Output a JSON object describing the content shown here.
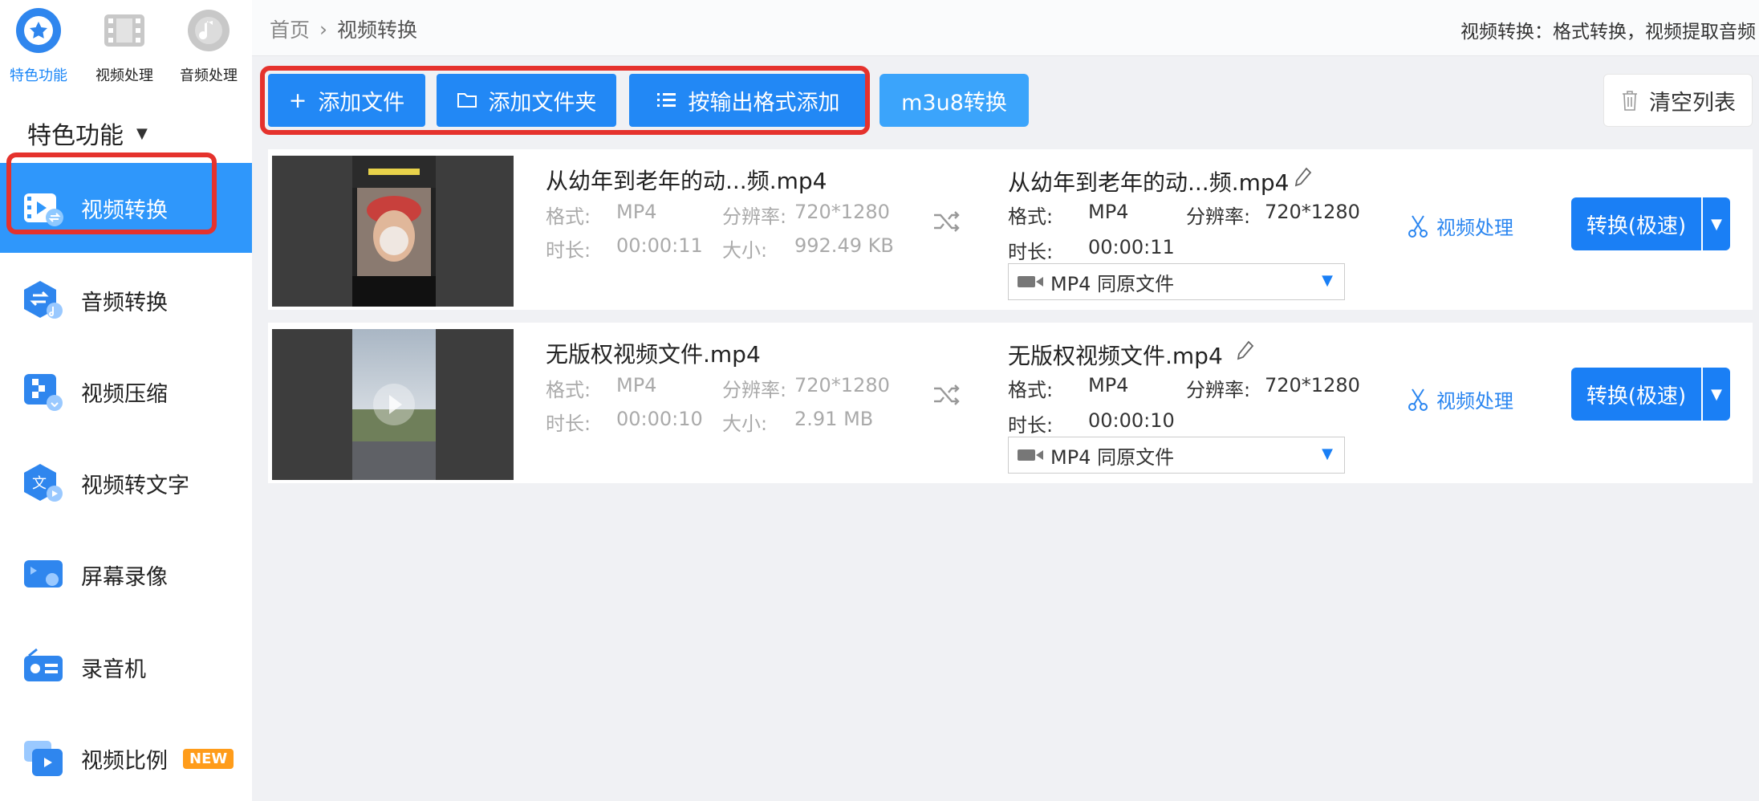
{
  "top_tabs": [
    {
      "label": "特色功能",
      "icon": "star-icon",
      "active": true
    },
    {
      "label": "视频处理",
      "icon": "film-icon",
      "active": false
    },
    {
      "label": "音频处理",
      "icon": "music-disc-icon",
      "active": false
    }
  ],
  "category": {
    "label": "特色功能"
  },
  "nav_items": [
    {
      "label": "视频转换",
      "icon": "video-convert-icon",
      "active": true
    },
    {
      "label": "音频转换",
      "icon": "audio-convert-icon"
    },
    {
      "label": "视频压缩",
      "icon": "video-compress-icon"
    },
    {
      "label": "视频转文字",
      "icon": "video-to-text-icon"
    },
    {
      "label": "屏幕录像",
      "icon": "screen-record-icon"
    },
    {
      "label": "录音机",
      "icon": "recorder-icon"
    },
    {
      "label": "视频比例",
      "icon": "video-ratio-icon",
      "badge": "NEW"
    }
  ],
  "header": {
    "breadcrumb_home": "首页",
    "breadcrumb_current": "视频转换",
    "description": "视频转换：格式转换，视频提取音频"
  },
  "toolbar": {
    "add_file": "添加文件",
    "add_folder": "添加文件夹",
    "add_by_format": "按输出格式添加",
    "m3u8": "m3u8转换",
    "clear_list": "清空列表"
  },
  "labels": {
    "format": "格式:",
    "resolution": "分辨率:",
    "duration": "时长:",
    "size": "大小:",
    "video_process": "视频处理",
    "convert": "转换(极速)"
  },
  "files": [
    {
      "name": "从幼年到老年的动...频.mp4",
      "format": "MP4",
      "resolution": "720*1280",
      "duration": "00:00:11",
      "size": "992.49 KB",
      "output_name": "从幼年到老年的动...频.mp4",
      "output_format": "MP4",
      "output_resolution": "720*1280",
      "output_duration": "00:00:11",
      "output_option": "MP4  同原文件"
    },
    {
      "name": "无版权视频文件.mp4",
      "format": "MP4",
      "resolution": "720*1280",
      "duration": "00:00:10",
      "size": "2.91 MB",
      "output_name": "无版权视频文件.mp4",
      "output_format": "MP4",
      "output_resolution": "720*1280",
      "output_duration": "00:00:10",
      "output_option": "MP4  同原文件"
    }
  ],
  "colors": {
    "accent": "#2288f5",
    "active_nav": "#2f97fb",
    "highlight": "#e5322d",
    "badge": "#ff9c1a"
  }
}
